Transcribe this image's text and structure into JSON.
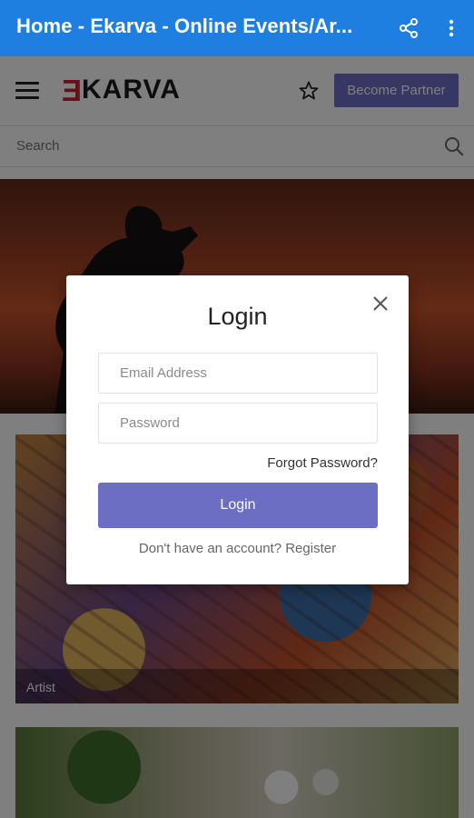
{
  "appbar": {
    "title": "Home - Ekarva - Online Events/Ar...",
    "share_icon": "share-icon",
    "more_icon": "more-vert-icon",
    "color": "#1e7fe0"
  },
  "navbar": {
    "logo_mark": "E",
    "logo_text": "KARVA",
    "favorite_icon": "star-outline-icon",
    "partner_button": "Become Partner",
    "accent": "#6c6ec4"
  },
  "search": {
    "placeholder": "Search"
  },
  "cards": [
    {
      "label": "Artist"
    }
  ],
  "login_modal": {
    "title": "Login",
    "email_placeholder": "Email Address",
    "password_placeholder": "Password",
    "forgot_password": "Forgot Password?",
    "login_button": "Login",
    "register_text": "Don't have an account? Register"
  }
}
